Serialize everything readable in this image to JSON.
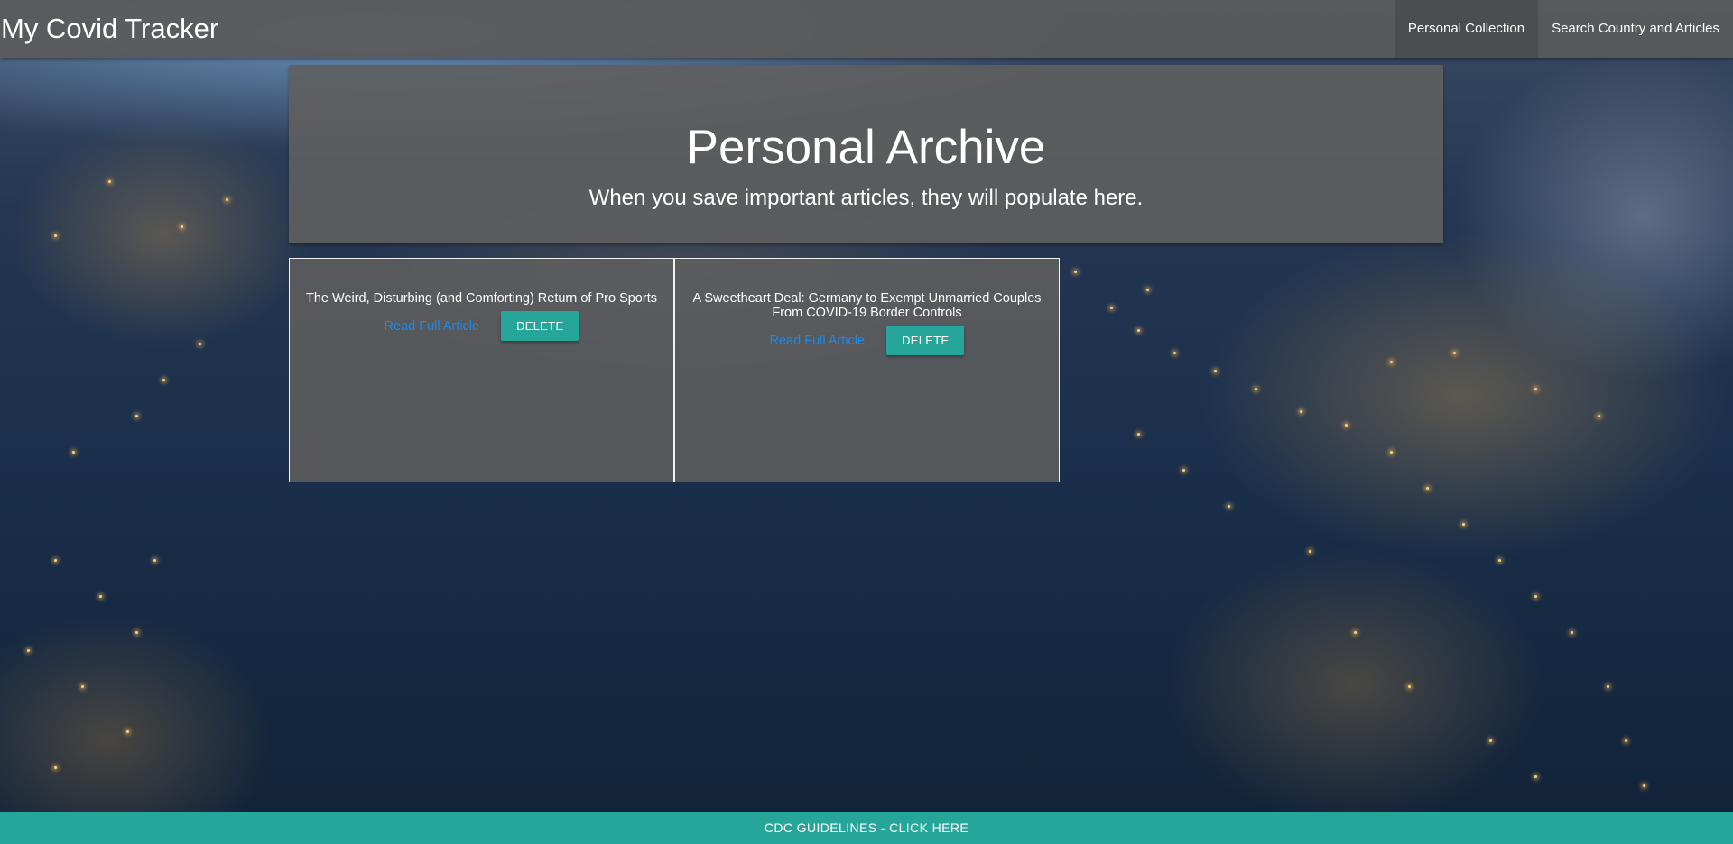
{
  "navbar": {
    "brand": "My Covid Tracker",
    "links": [
      {
        "label": "Personal Collection",
        "active": true
      },
      {
        "label": "Search Country and Articles",
        "active": false
      }
    ]
  },
  "hero": {
    "title": "Personal Archive",
    "subtitle": "When you save important articles, they will populate here."
  },
  "articles": [
    {
      "title": "The Weird, Disturbing (and Comforting) Return of Pro Sports",
      "link_label": "Read Full Article",
      "delete_label": "DELETE"
    },
    {
      "title": "A Sweetheart Deal: Germany to Exempt Unmarried Couples From COVID-19 Border Controls",
      "link_label": "Read Full Article",
      "delete_label": "DELETE"
    }
  ],
  "footer": {
    "label": "CDC GUIDELINES - CLICK HERE"
  },
  "colors": {
    "accent": "#26a69a",
    "link": "#1e88e5",
    "panel": "#5f5f5f"
  }
}
